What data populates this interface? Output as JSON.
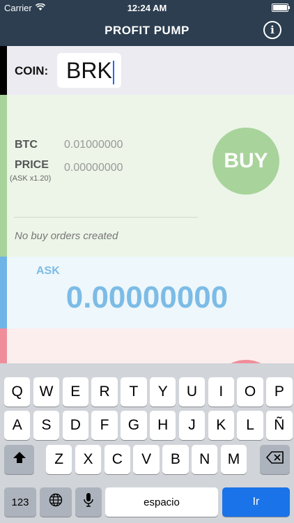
{
  "status": {
    "carrier": "Carrier",
    "time": "12:24 AM"
  },
  "nav": {
    "title": "PROFIT PUMP",
    "info": "i"
  },
  "coin": {
    "label": "COIN:",
    "value": "BRK"
  },
  "buy": {
    "btc_label": "BTC",
    "btc_value": "0.01000000",
    "price_label": "PRICE",
    "price_value": "0.00000000",
    "ask_multiplier": "(ASK x1.20)",
    "button_label": "BUY",
    "orders_status": "No buy orders created"
  },
  "ask": {
    "label": "ASK",
    "value": "0.00000000"
  },
  "colors": {
    "nav": "#2c3e50",
    "buy": "#a8d39b",
    "ask": "#7cbce6",
    "sell": "#ef8e9a",
    "go": "#1a73e8"
  },
  "keyboard": {
    "row1": [
      "Q",
      "W",
      "E",
      "R",
      "T",
      "Y",
      "U",
      "I",
      "O",
      "P"
    ],
    "row2": [
      "A",
      "S",
      "D",
      "F",
      "G",
      "H",
      "J",
      "K",
      "L",
      "Ñ"
    ],
    "row3": [
      "Z",
      "X",
      "C",
      "V",
      "B",
      "N",
      "M"
    ],
    "numbers_key": "123",
    "space_key": "espacio",
    "return_key": "Ir",
    "shift_icon": "shift-icon",
    "delete_icon": "backspace-icon",
    "globe_icon": "globe-icon",
    "mic_icon": "microphone-icon"
  }
}
